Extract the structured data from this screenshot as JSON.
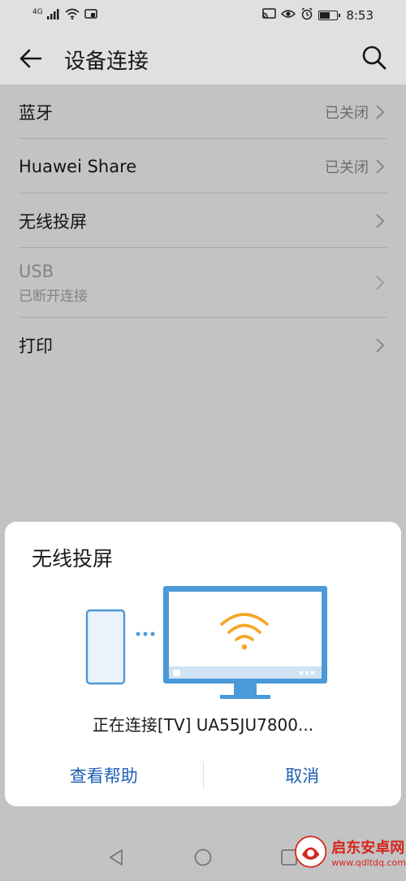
{
  "status_bar": {
    "network_label": "4G",
    "time": "8:53",
    "battery_level": 0.55
  },
  "app_bar": {
    "title": "设备连接"
  },
  "settings": [
    {
      "label": "蓝牙",
      "value": "已关闭"
    },
    {
      "label": "Huawei Share",
      "value": "已关闭"
    },
    {
      "label": "无线投屏",
      "value": ""
    },
    {
      "label": "USB",
      "sub": "已断开连接",
      "disabled": true
    },
    {
      "label": "打印",
      "value": ""
    }
  ],
  "dialog": {
    "title": "无线投屏",
    "status": "正在连接[TV] UA55JU7800...",
    "help_label": "查看帮助",
    "cancel_label": "取消"
  },
  "watermark": {
    "title": "启东安卓网",
    "url": "www.qdltdq.com"
  },
  "colors": {
    "accent": "#1e5fb4",
    "illustration_blue": "#4a9ad9",
    "wifi_orange": "#f5a623",
    "watermark_red": "#d7261d"
  }
}
